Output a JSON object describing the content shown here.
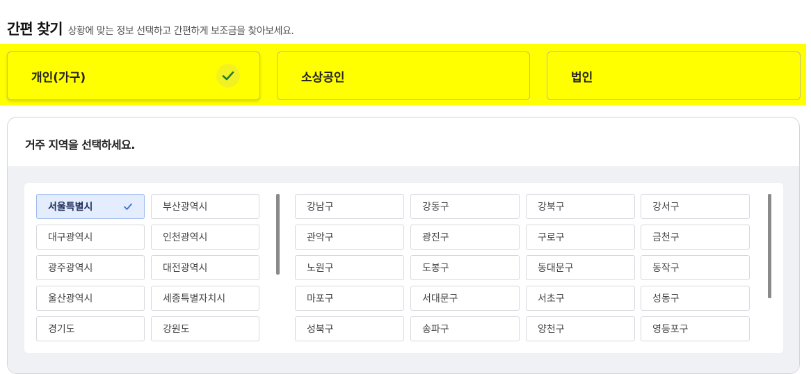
{
  "header": {
    "title": "간편 찾기",
    "subtitle": "상황에 맞는 정보 선택하고 간편하게 보조금을 찾아보세요."
  },
  "user_types": [
    {
      "label": "개인(가구)",
      "selected": true
    },
    {
      "label": "소상공인",
      "selected": false
    },
    {
      "label": "법인",
      "selected": false
    }
  ],
  "region": {
    "prompt": "거주 지역을 선택하세요.",
    "provinces": [
      {
        "label": "서울특별시",
        "selected": true
      },
      {
        "label": "부산광역시",
        "selected": false
      },
      {
        "label": "대구광역시",
        "selected": false
      },
      {
        "label": "인천광역시",
        "selected": false
      },
      {
        "label": "광주광역시",
        "selected": false
      },
      {
        "label": "대전광역시",
        "selected": false
      },
      {
        "label": "울산광역시",
        "selected": false
      },
      {
        "label": "세종특별자치시",
        "selected": false
      },
      {
        "label": "경기도",
        "selected": false
      },
      {
        "label": "강원도",
        "selected": false
      }
    ],
    "districts": [
      "강남구",
      "강동구",
      "강북구",
      "강서구",
      "관악구",
      "광진구",
      "구로구",
      "금천구",
      "노원구",
      "도봉구",
      "동대문구",
      "동작구",
      "마포구",
      "서대문구",
      "서초구",
      "성동구",
      "성북구",
      "송파구",
      "양천구",
      "영등포구"
    ]
  },
  "colors": {
    "highlight": "#ffff00",
    "selected_chip_bg": "#e4edfd",
    "check_green": "#1f7a3a",
    "check_blue": "#3a6fd8"
  }
}
